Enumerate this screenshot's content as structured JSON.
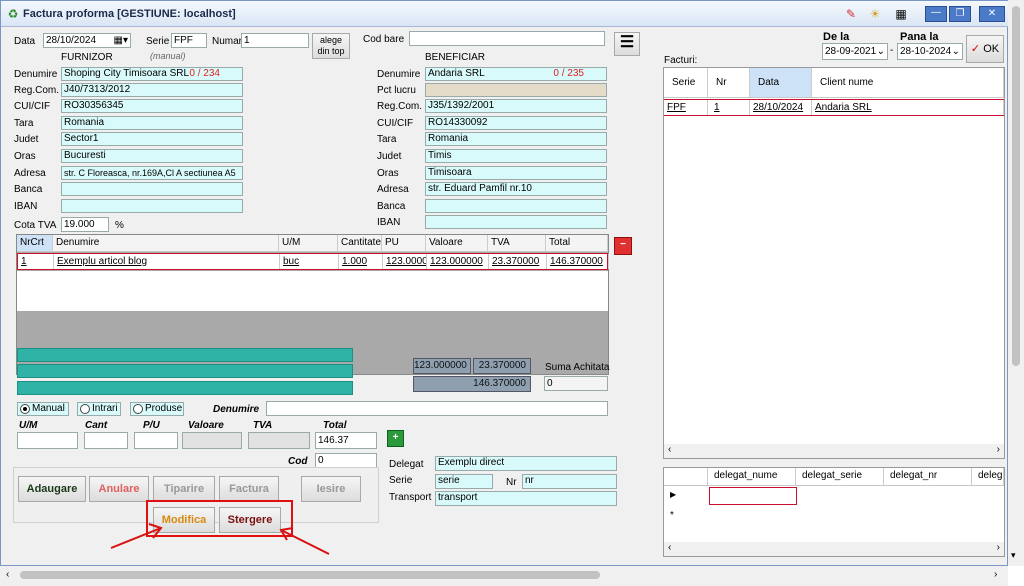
{
  "window": {
    "title": "Factura proforma [GESTIUNE: localhost]"
  },
  "header": {
    "data_label": "Data",
    "data_value": "28/10/2024",
    "serie_label": "Serie",
    "serie_value": "FPF",
    "numar_label": "Numar",
    "numar_value": "1",
    "manual_hint": "(manual)",
    "alege_label": "alege din top",
    "cod_bare_label": "Cod bare",
    "cod_bare_value": ""
  },
  "furnizor": {
    "heading": "FURNIZOR",
    "denumire_label": "Denumire",
    "denumire_value": "Shoping City Timisoara SRL",
    "denumire_count": "0 / 234",
    "regcom_label": "Reg.Com.",
    "regcom_value": "J40/7313/2012",
    "cui_label": "CUI/CIF",
    "cui_value": "RO30356345",
    "tara_label": "Tara",
    "tara_value": "Romania",
    "judet_label": "Judet",
    "judet_value": "Sector1",
    "oras_label": "Oras",
    "oras_value": "Bucuresti",
    "adresa_label": "Adresa",
    "adresa_value": "str. C Floreasca, nr.169A,Cl A sectiunea A5",
    "banca_label": "Banca",
    "banca_value": "",
    "iban_label": "IBAN",
    "iban_value": "",
    "cota_label": "Cota TVA",
    "cota_value": "19.000",
    "cota_unit": "%"
  },
  "beneficiar": {
    "heading": "BENEFICIAR",
    "denumire_label": "Denumire",
    "denumire_value": "Andaria SRL",
    "denumire_count": "0 / 235",
    "pct_label": "Pct lucru",
    "pct_value": "",
    "regcom_label": "Reg.Com.",
    "regcom_value": "J35/1392/2001",
    "cui_label": "CUI/CIF",
    "cui_value": "RO14330092",
    "tara_label": "Tara",
    "tara_value": "Romania",
    "judet_label": "Judet",
    "judet_value": "Timis",
    "oras_label": "Oras",
    "oras_value": "Timisoara",
    "adresa_label": "Adresa",
    "adresa_value": "str. Eduard Pamfil nr.10",
    "banca_label": "Banca",
    "banca_value": "",
    "iban_label": "IBAN",
    "iban_value": ""
  },
  "items": {
    "headers": {
      "nrcrt": "NrCrt",
      "denumire": "Denumire",
      "um": "U/M",
      "cantitate": "Cantitate",
      "pu": "PU",
      "valoare": "Valoare",
      "tva": "TVA",
      "total": "Total"
    },
    "row": {
      "nrcrt": "1",
      "denumire": "Exemplu articol blog",
      "um": "buc",
      "cantitate": "1.000",
      "pu": "123.0000",
      "valoare": "123.000000",
      "tva": "23.370000",
      "total": "146.370000"
    }
  },
  "totals": {
    "valoare": "123.000000",
    "tva": "23.370000",
    "total": "146.370000",
    "suma_achitata_label": "Suma Achitata",
    "suma_achitata_value": "0"
  },
  "entry": {
    "manual_label": "Manual",
    "intrari_label": "Intrari",
    "produse_label": "Produse",
    "denumire_label": "Denumire",
    "um_label": "U/M",
    "cant_label": "Cant",
    "pu_label": "P/U",
    "valoare_label": "Valoare",
    "tva_label": "TVA",
    "total_label": "Total",
    "total_value": "146.37",
    "cod_label": "Cod",
    "cod_value": "0"
  },
  "delegat": {
    "delegat_label": "Delegat",
    "delegat_value": "Exemplu direct",
    "serie_label": "Serie",
    "serie_value": "serie",
    "nr_label": "Nr",
    "nr_value": "nr",
    "transport_label": "Transport",
    "transport_value": "transport"
  },
  "buttons": {
    "adaugare": "Adaugare",
    "anulare": "Anulare",
    "tiparire": "Tiparire",
    "factura": "Factura",
    "iesire": "Iesire",
    "modifica": "Modifica",
    "stergere": "Stergere",
    "ok": "OK"
  },
  "filter": {
    "de_la_label": "De la",
    "de_la_value": "28-09-2021",
    "pana_la_label": "Pana la",
    "pana_la_value": "28-10-2024",
    "facturi_label": "Facturi:"
  },
  "invoices": {
    "headers": {
      "serie": "Serie",
      "nr": "Nr",
      "data": "Data",
      "client": "Client nume"
    },
    "row": {
      "serie": "FPF",
      "nr": "1",
      "data": "28/10/2024",
      "client": "Andaria SRL"
    }
  },
  "delegati": {
    "headers": {
      "nume": "delegat_nume",
      "serie": "delegat_serie",
      "nr": "delegat_nr",
      "extra": "delega"
    }
  },
  "colors": {
    "accent_red": "#d82020",
    "cyan_field": "#d9fafa",
    "teal": "#2fb3a6"
  }
}
